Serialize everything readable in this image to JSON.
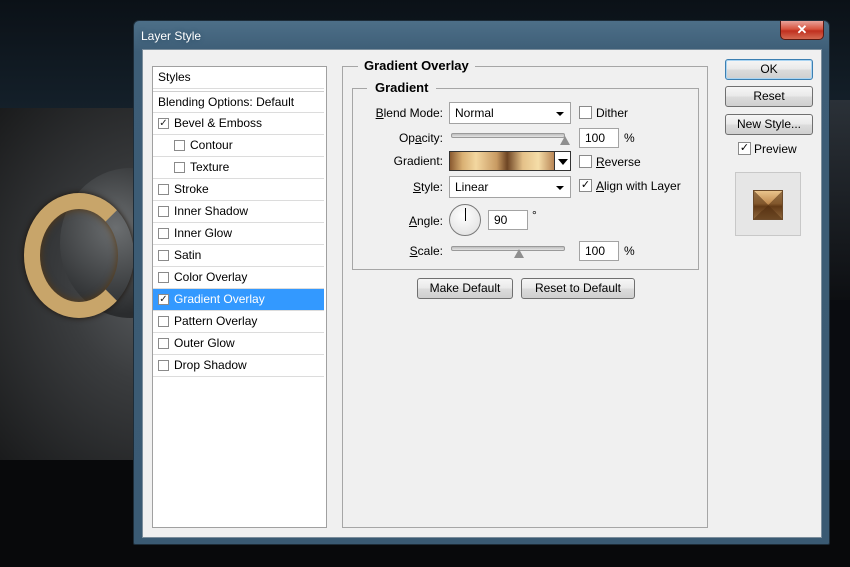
{
  "window": {
    "title": "Layer Style",
    "close_glyph": "✕"
  },
  "styles_list": {
    "header": "Styles",
    "blending_options": "Blending Options: Default",
    "items": [
      {
        "label": "Bevel & Emboss",
        "checked": true,
        "indent": false
      },
      {
        "label": "Contour",
        "checked": false,
        "indent": true
      },
      {
        "label": "Texture",
        "checked": false,
        "indent": true
      },
      {
        "label": "Stroke",
        "checked": false,
        "indent": false
      },
      {
        "label": "Inner Shadow",
        "checked": false,
        "indent": false
      },
      {
        "label": "Inner Glow",
        "checked": false,
        "indent": false
      },
      {
        "label": "Satin",
        "checked": false,
        "indent": false
      },
      {
        "label": "Color Overlay",
        "checked": false,
        "indent": false
      },
      {
        "label": "Gradient Overlay",
        "checked": true,
        "indent": false,
        "selected": true
      },
      {
        "label": "Pattern Overlay",
        "checked": false,
        "indent": false
      },
      {
        "label": "Outer Glow",
        "checked": false,
        "indent": false
      },
      {
        "label": "Drop Shadow",
        "checked": false,
        "indent": false
      }
    ]
  },
  "panel": {
    "title": "Gradient Overlay",
    "group_title": "Gradient",
    "blend_mode": {
      "label_pre": "B",
      "label_post": "lend Mode:",
      "value": "Normal"
    },
    "dither": {
      "label": "Dither",
      "checked": false
    },
    "opacity": {
      "label_pre": "Op",
      "label_u": "a",
      "label_post": "city:",
      "value": "100",
      "unit": "%",
      "level": 1.0
    },
    "gradient": {
      "label": "Gradient:"
    },
    "reverse": {
      "label_u": "R",
      "label_post": "everse",
      "checked": false
    },
    "style": {
      "label_pre": "",
      "label_u": "S",
      "label_post": "tyle:",
      "value": "Linear"
    },
    "align": {
      "label_pre": "",
      "label_u": "A",
      "label_post": "lign with Layer",
      "checked": true
    },
    "angle": {
      "label_u": "A",
      "label_post": "ngle:",
      "value": "90",
      "unit": "°"
    },
    "scale": {
      "label_u": "S",
      "label_post": "cale:",
      "value": "100",
      "unit": "%",
      "level": 0.6
    },
    "make_default": "Make Default",
    "reset_default": "Reset to Default"
  },
  "buttons": {
    "ok": "OK",
    "reset": "Reset",
    "new_style": "New Style...",
    "preview": {
      "label": "Preview",
      "checked": true
    }
  },
  "colors": {
    "selection": "#3399ff",
    "title_bar": "#3d5d76"
  }
}
